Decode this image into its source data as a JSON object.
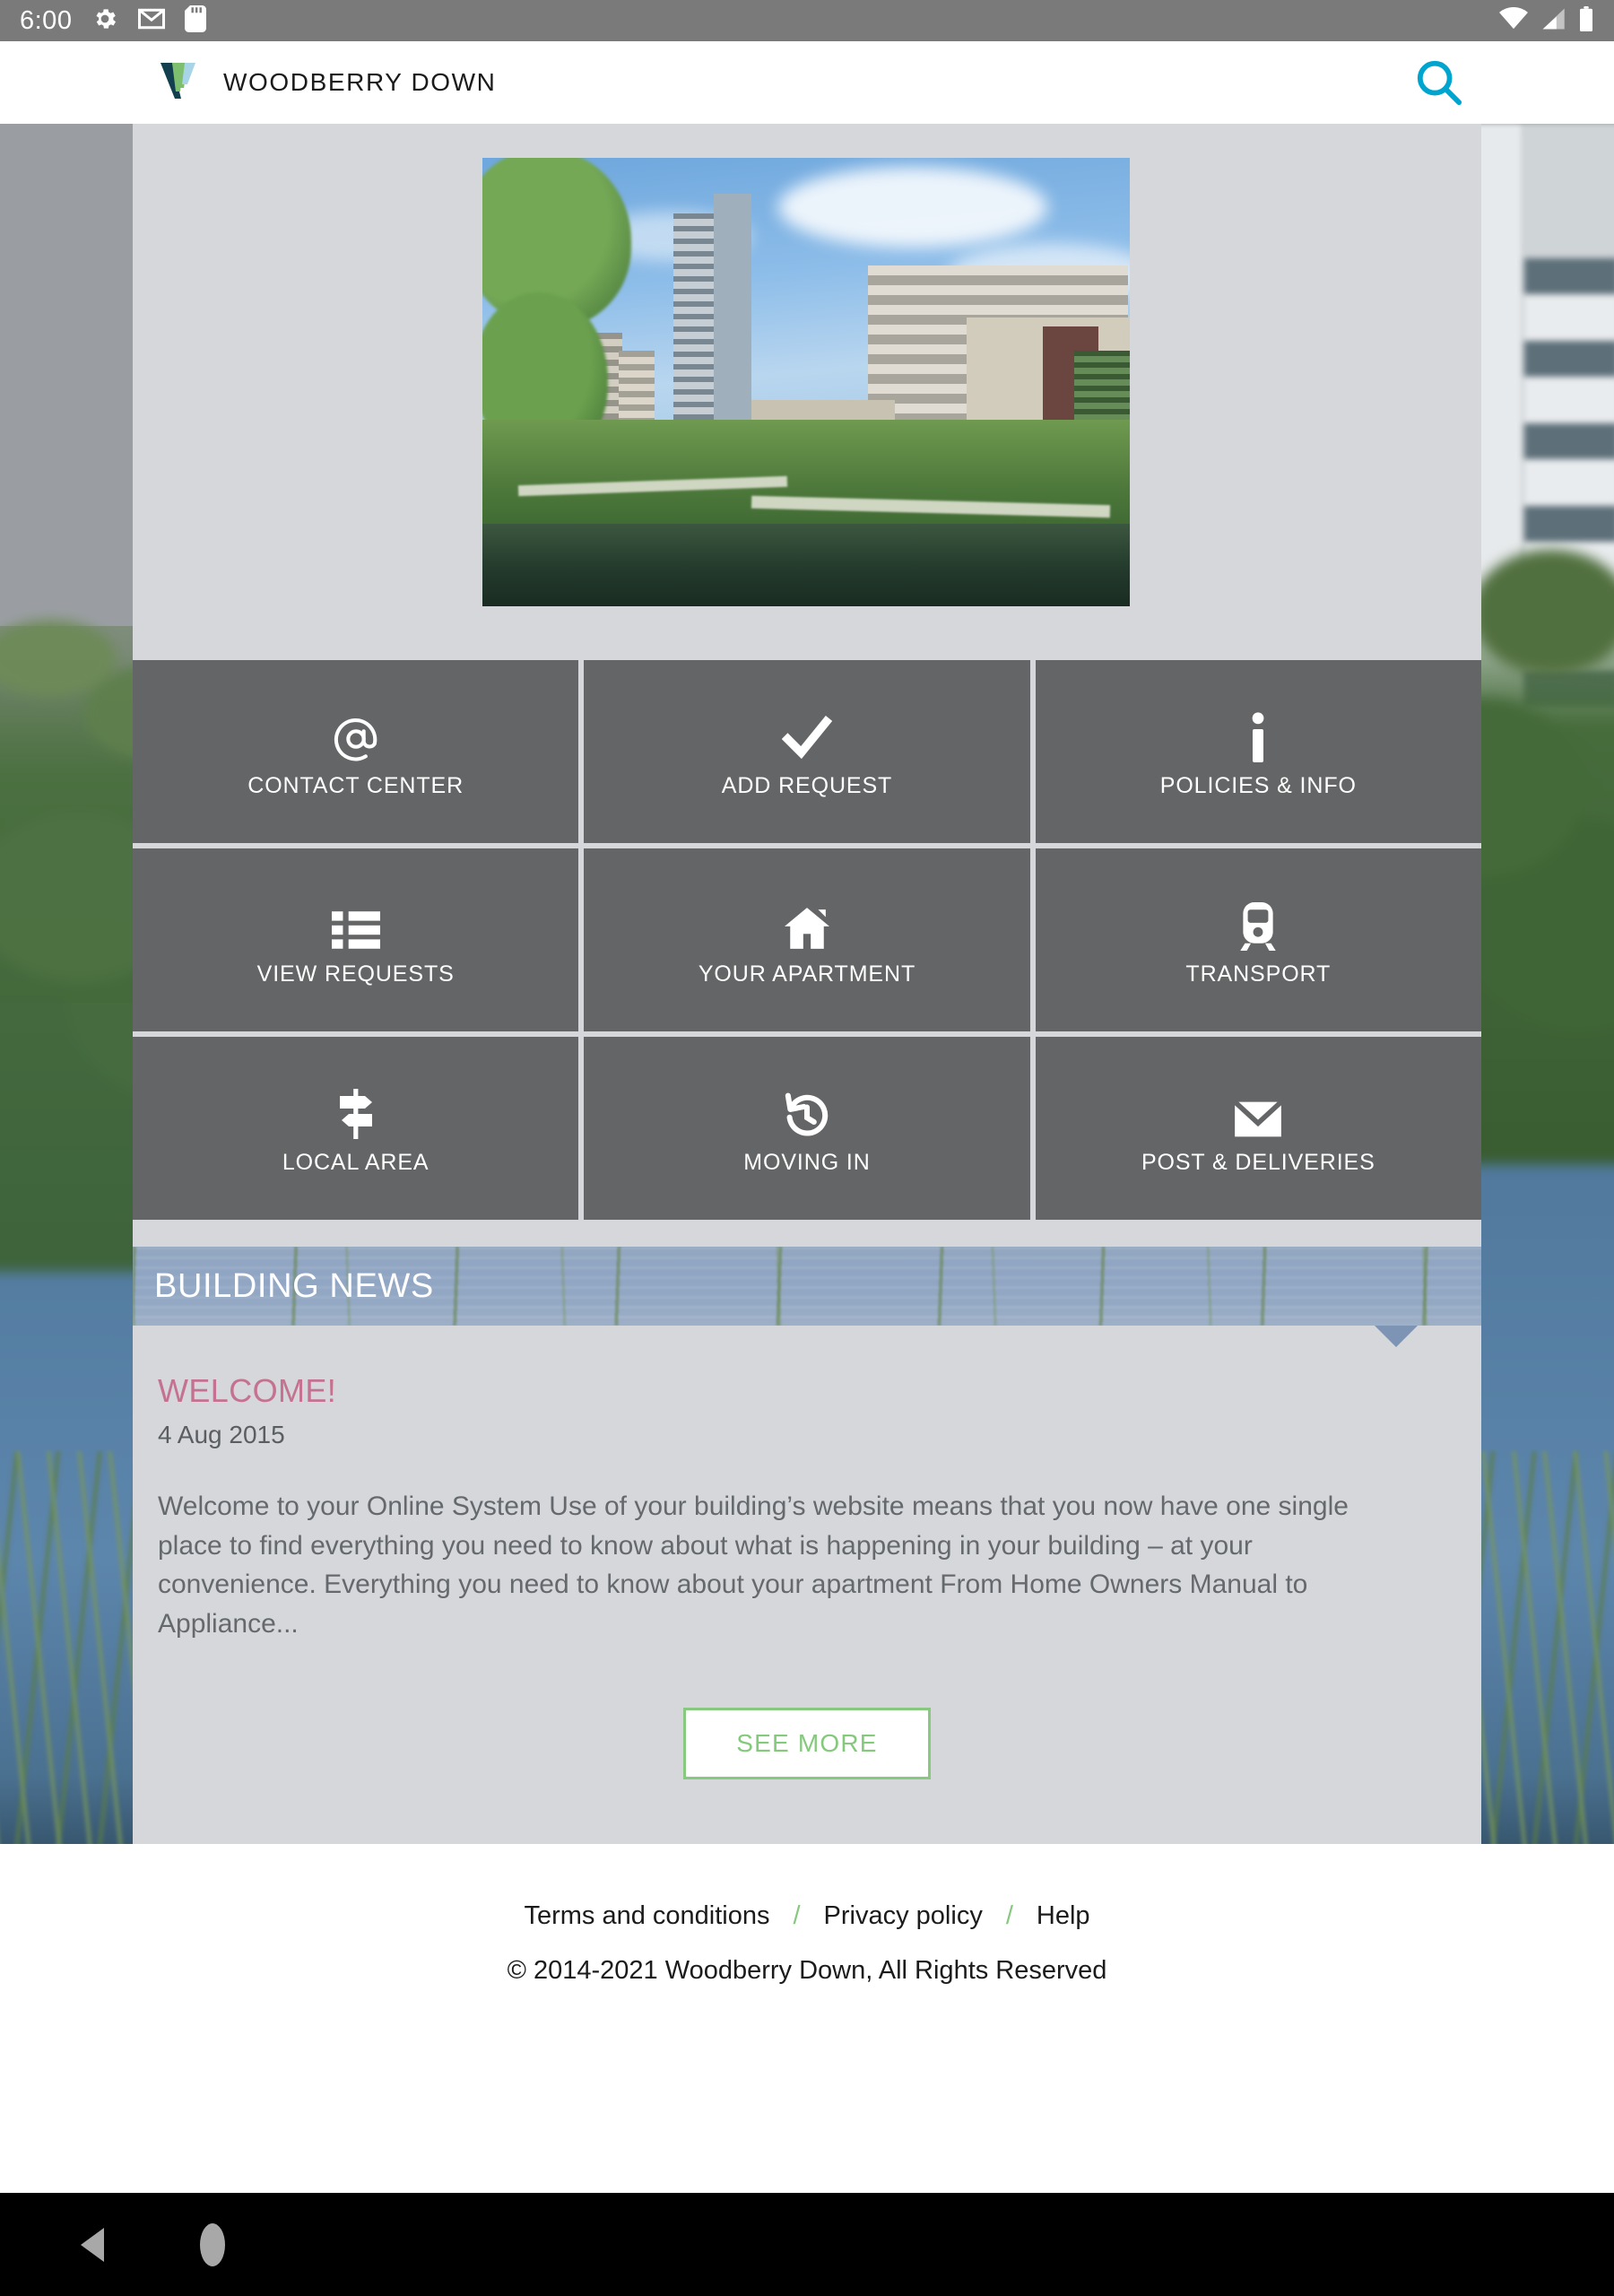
{
  "status_bar": {
    "time": "6:00",
    "left_icons": [
      "gear-icon",
      "gmail-icon",
      "sd-card-icon"
    ],
    "right_icons": [
      "wifi-icon",
      "cellular-signal-icon",
      "battery-icon"
    ]
  },
  "header": {
    "brand_name": "WOODBERRY DOWN",
    "logo_colors": {
      "navy": "#12404f",
      "green": "#7dbf6e",
      "light_blue": "#a8d4e8"
    },
    "accent_color": "#00A5CF",
    "search_icon": "search-icon",
    "menu_icon": "hamburger-menu-icon"
  },
  "hero": {
    "alt": "Woodberry Down residential development beside canal"
  },
  "tiles": [
    {
      "label": "CONTACT CENTER",
      "icon": "at-sign-icon"
    },
    {
      "label": "ADD REQUEST",
      "icon": "checkmark-icon"
    },
    {
      "label": "POLICIES & INFO",
      "icon": "info-icon"
    },
    {
      "label": "VIEW REQUESTS",
      "icon": "list-icon"
    },
    {
      "label": "YOUR APARTMENT",
      "icon": "home-icon"
    },
    {
      "label": "TRANSPORT",
      "icon": "train-icon"
    },
    {
      "label": "LOCAL AREA",
      "icon": "signpost-icon"
    },
    {
      "label": "MOVING IN",
      "icon": "history-clock-icon"
    },
    {
      "label": "POST & DELIVERIES",
      "icon": "envelope-icon"
    }
  ],
  "news": {
    "section_title": "BUILDING NEWS",
    "headline": "WELCOME!",
    "headline_color": "#c4728f",
    "date": "4 Aug 2015",
    "body": "Welcome to your Online System Use of your building’s website means that you now have one single place to find everything you need to know about what is happening in your building – at your convenience. Everything you need to know about your apartment From Home Owners Manual to Appliance...",
    "see_more_label": "SEE MORE",
    "see_more_color": "#84c97c"
  },
  "footer": {
    "links": [
      "Terms and conditions",
      "Privacy policy",
      "Help"
    ],
    "separator": "/",
    "separator_color": "#86c97f",
    "copyright": "© 2014-2021 Woodberry Down, All Rights Reserved"
  },
  "nav_bar": {
    "back_icon": "back-triangle-icon",
    "home_icon": "home-circle-icon"
  }
}
